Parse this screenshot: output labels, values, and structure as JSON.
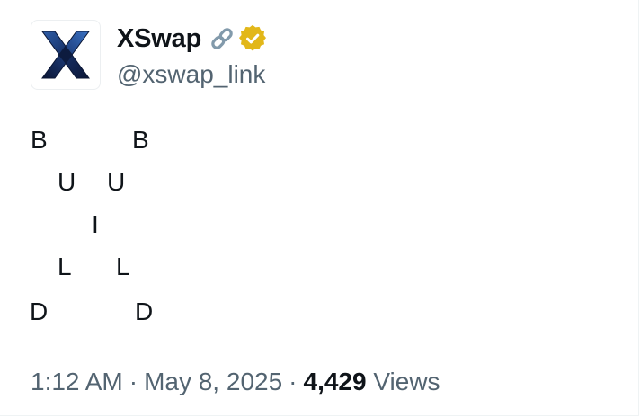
{
  "author": {
    "display_name": "XSwap",
    "handle": "@xswap_link",
    "avatar_icon": "xswap-logo",
    "badges": [
      "link-icon",
      "verified-gold-badge-icon"
    ],
    "badge_color": "#e2b719"
  },
  "tweet": {
    "lines": [
      {
        "chars": [
          "B",
          "B"
        ]
      },
      {
        "chars": [
          "U",
          "U"
        ]
      },
      {
        "chars": [
          "I"
        ]
      },
      {
        "chars": [
          "L",
          "L"
        ]
      },
      {
        "chars": [
          "D",
          "D"
        ]
      }
    ]
  },
  "meta": {
    "time": "1:12 AM",
    "separator": "·",
    "date": "May 8, 2025",
    "views_count": "4,429",
    "views_label": "Views"
  }
}
